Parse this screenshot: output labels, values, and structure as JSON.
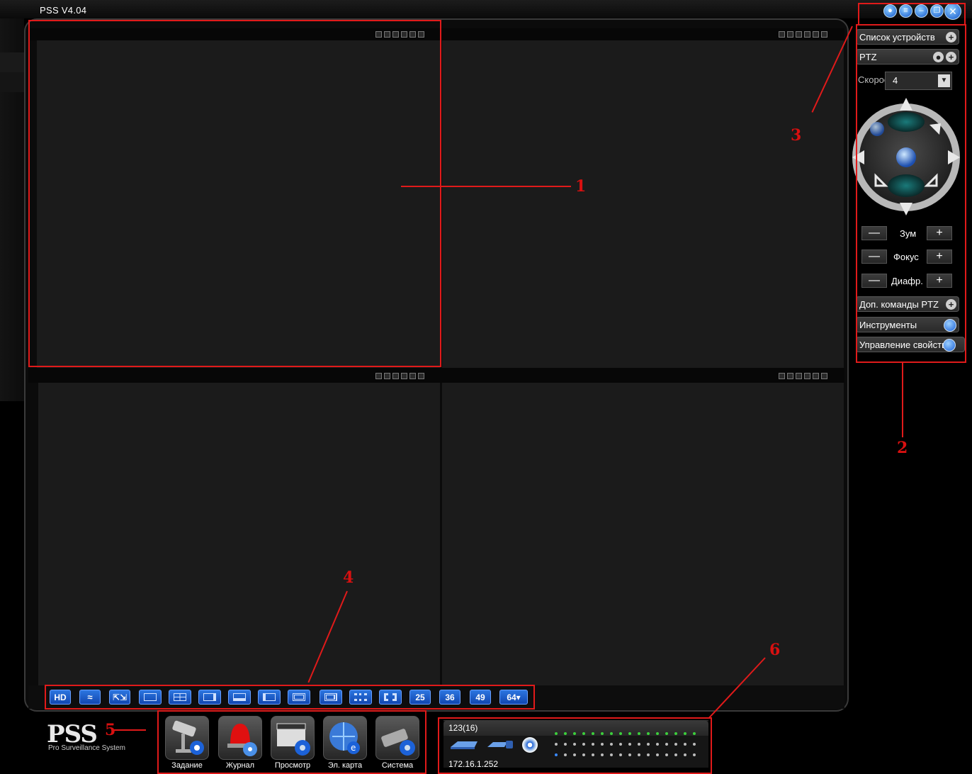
{
  "app": {
    "title": "PSS  V4.04"
  },
  "annotations": [
    "1",
    "2",
    "3",
    "4",
    "5",
    "6"
  ],
  "right_panel": {
    "device_list": "Список устройств",
    "ptz": "PTZ",
    "speed_label": "Скорость:",
    "speed_value": "4",
    "zoom": "Зум",
    "focus": "Фокус",
    "iris": "Диафр.",
    "minus": "—",
    "plus": "+",
    "ptz_extra": "Доп. команды PTZ",
    "tools": "Инструменты",
    "properties": "Управление свойства"
  },
  "layout_toolbar": {
    "hd": "HD",
    "n25": "25",
    "n36": "36",
    "n49": "49",
    "n64": "64▾"
  },
  "brand": {
    "logo": "PSS",
    "tagline": "Pro Surveillance System"
  },
  "apps": [
    {
      "label": "Задание"
    },
    {
      "label": "Журнал"
    },
    {
      "label": "Просмотр"
    },
    {
      "label": "Эл. карта"
    },
    {
      "label": "Система"
    }
  ],
  "status": {
    "user": "123(16)",
    "ip": "172.16.1.252"
  },
  "colors": {
    "annotation": "#e01a1a",
    "accent": "#1c62d8",
    "led_green": "#3ccf3c"
  }
}
